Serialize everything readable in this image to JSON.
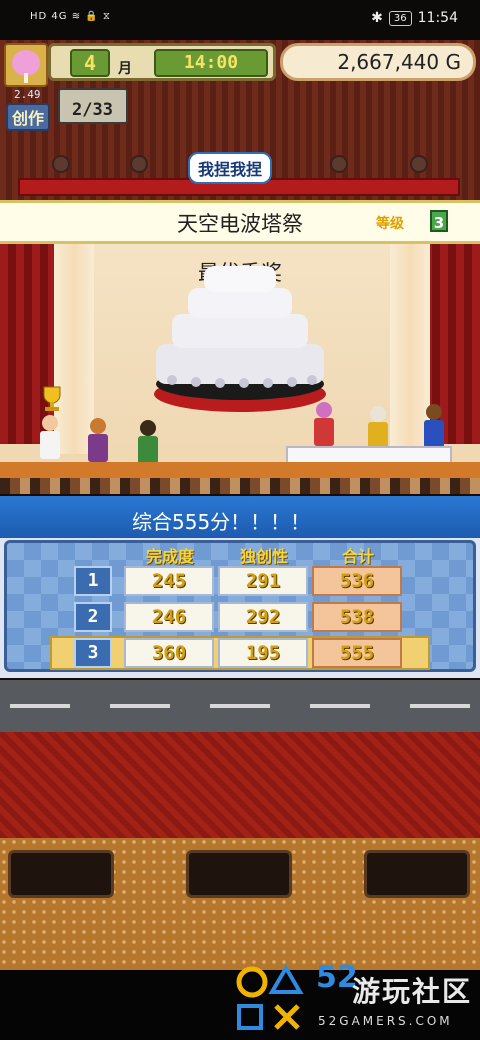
{
  "status_bar": {
    "left_icons": "HD 4G ≋ 🔒 ⧖",
    "battery": "36",
    "time": "11:54"
  },
  "hud": {
    "month_number": "4",
    "month_unit": "月",
    "time": "14:00",
    "money": "2,667,440 G",
    "create_label": "创作",
    "create_small_value": "2.49",
    "create_count": "2/33",
    "speech_bubble": "我捏我捏"
  },
  "event": {
    "title": "天空电波塔祭",
    "level_label": "等级",
    "level_value": "3",
    "award": "最优秀奖"
  },
  "results": {
    "summary": "综合555分！！！！",
    "columns": [
      "完成度",
      "独创性",
      "合计"
    ],
    "rows": [
      {
        "rank": "1",
        "completion": "245",
        "originality": "291",
        "total": "536"
      },
      {
        "rank": "2",
        "completion": "246",
        "originality": "292",
        "total": "538"
      },
      {
        "rank": "3",
        "completion": "360",
        "originality": "195",
        "total": "555"
      }
    ]
  },
  "watermark": {
    "number": "52",
    "site_cn": "游玩社区",
    "site_en": "52GAMERS.COM"
  },
  "colors": {
    "accent_blue": "#2a78d2",
    "stage_red": "#b31c1c",
    "highlight_gold": "#f0d070"
  }
}
